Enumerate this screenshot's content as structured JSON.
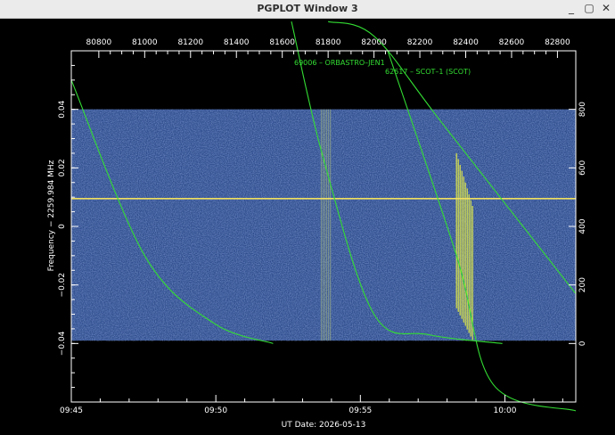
{
  "window": {
    "title": "PGPLOT Window 3",
    "buttons": {
      "minimize": "_",
      "maximize": "▢",
      "close": "✕"
    }
  },
  "colors": {
    "background": "#000000",
    "axes": "#ffffff",
    "curves": "#33dd33",
    "waterfall": "#2e4c8c",
    "signal": "#e8e84a",
    "marker_line": "#f0e060"
  },
  "chart_data": {
    "type": "heatmap",
    "xlabel": "UT Date: 2026-05-13",
    "ylabel": "Frequency − 2259.984 MHz",
    "x_bottom_ticks": [
      "09:45",
      "09:50",
      "09:55",
      "10:00"
    ],
    "x_top_ticks": [
      "80800",
      "81000",
      "81200",
      "81400",
      "81600",
      "81800",
      "82000",
      "82200",
      "82400",
      "82600",
      "82800"
    ],
    "y_left_ticks": [
      "0.04",
      "0.02",
      "0",
      "−0.02",
      "−0.04"
    ],
    "y_left_range": [
      -0.06,
      0.06
    ],
    "y_right_ticks": [
      "800",
      "600",
      "400",
      "200",
      "0"
    ],
    "y_right_range": [
      -200,
      1000
    ],
    "top_axis_range": [
      80680,
      82880
    ],
    "waterfall_freq_range": [
      -0.039,
      0.04
    ],
    "marker_frequency": 0.0095,
    "annotations": [
      {
        "text": "69006 – ORBASTRO–JEN1",
        "target": 0
      },
      {
        "text": "62617 – SCOT–1 (SCOT)",
        "target": 1
      }
    ],
    "series": [
      {
        "points": [
          [
            80680,
            0.05
          ],
          [
            81000,
            -0.01
          ],
          [
            81300,
            -0.033
          ],
          [
            81560,
            -0.04
          ]
        ]
      },
      {
        "points": [
          [
            81640,
            0.07
          ],
          [
            81780,
            0.023
          ],
          [
            82000,
            -0.03
          ],
          [
            82240,
            -0.037
          ],
          [
            82560,
            -0.04
          ]
        ]
      },
      {
        "points": [
          [
            82060,
            0.06
          ],
          [
            82360,
            -0.01
          ],
          [
            82520,
            -0.054
          ],
          [
            82880,
            -0.063
          ]
        ]
      },
      {
        "points": [
          [
            81800,
            0.07
          ],
          [
            82000,
            0.065
          ],
          [
            82300,
            0.035
          ],
          [
            82880,
            -0.023
          ]
        ]
      }
    ],
    "bright_bands": [
      {
        "x_range": [
          81770,
          81810
        ],
        "strength": "medium"
      },
      {
        "x_range": [
          82360,
          82430
        ],
        "strength": "strong"
      }
    ]
  }
}
